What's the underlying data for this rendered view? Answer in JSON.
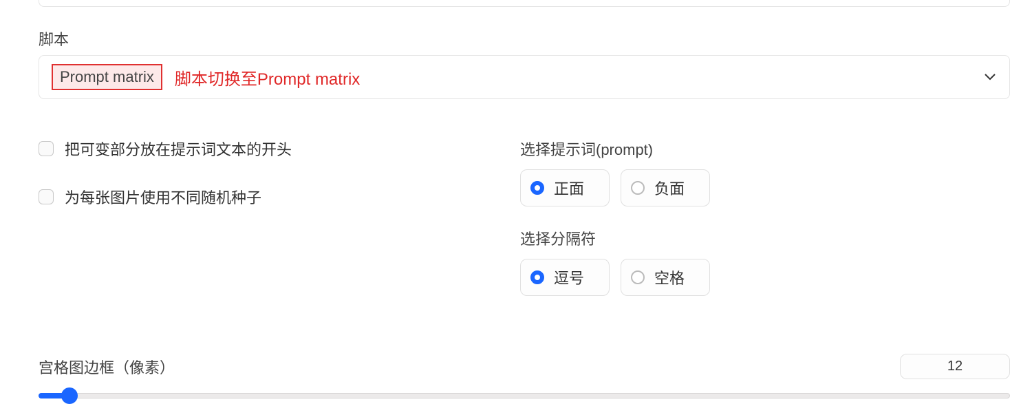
{
  "script": {
    "section_label": "脚本",
    "selected_value": "Prompt matrix",
    "annotation": "脚本切换至Prompt matrix"
  },
  "checkboxes": {
    "variable_at_start": {
      "label": "把可变部分放在提示词文本的开头",
      "checked": false
    },
    "different_seed": {
      "label": "为每张图片使用不同随机种子",
      "checked": false
    }
  },
  "prompt_select": {
    "label": "选择提示词(prompt)",
    "options": [
      {
        "label": "正面",
        "checked": true
      },
      {
        "label": "负面",
        "checked": false
      }
    ]
  },
  "separator_select": {
    "label": "选择分隔符",
    "options": [
      {
        "label": "逗号",
        "checked": true
      },
      {
        "label": "空格",
        "checked": false
      }
    ]
  },
  "grid_border": {
    "label": "宫格图边框（像素）",
    "value": "12"
  },
  "colors": {
    "accent": "#1a66ff",
    "annotation": "#e02828"
  }
}
